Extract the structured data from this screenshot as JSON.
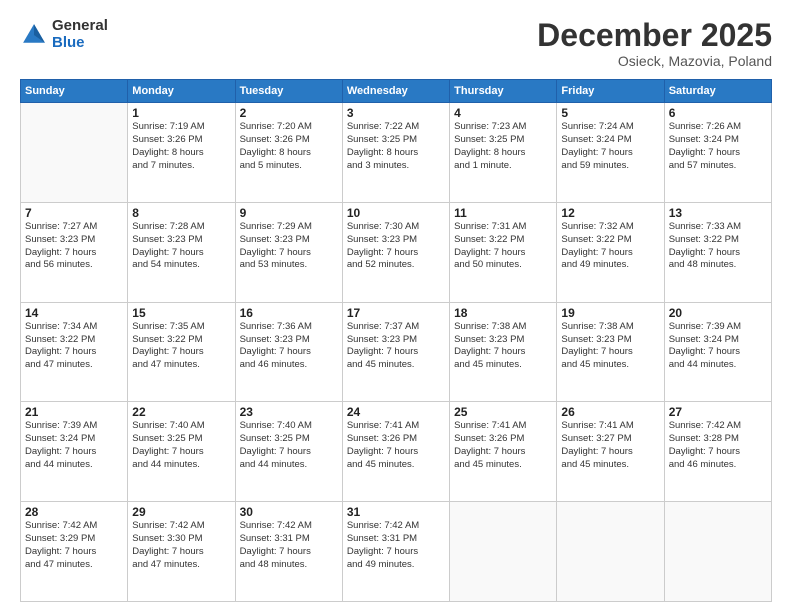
{
  "header": {
    "logo_general": "General",
    "logo_blue": "Blue",
    "month_title": "December 2025",
    "location": "Osieck, Mazovia, Poland"
  },
  "weekdays": [
    "Sunday",
    "Monday",
    "Tuesday",
    "Wednesday",
    "Thursday",
    "Friday",
    "Saturday"
  ],
  "weeks": [
    [
      {
        "day": "",
        "info": ""
      },
      {
        "day": "1",
        "info": "Sunrise: 7:19 AM\nSunset: 3:26 PM\nDaylight: 8 hours\nand 7 minutes."
      },
      {
        "day": "2",
        "info": "Sunrise: 7:20 AM\nSunset: 3:26 PM\nDaylight: 8 hours\nand 5 minutes."
      },
      {
        "day": "3",
        "info": "Sunrise: 7:22 AM\nSunset: 3:25 PM\nDaylight: 8 hours\nand 3 minutes."
      },
      {
        "day": "4",
        "info": "Sunrise: 7:23 AM\nSunset: 3:25 PM\nDaylight: 8 hours\nand 1 minute."
      },
      {
        "day": "5",
        "info": "Sunrise: 7:24 AM\nSunset: 3:24 PM\nDaylight: 7 hours\nand 59 minutes."
      },
      {
        "day": "6",
        "info": "Sunrise: 7:26 AM\nSunset: 3:24 PM\nDaylight: 7 hours\nand 57 minutes."
      }
    ],
    [
      {
        "day": "7",
        "info": "Sunrise: 7:27 AM\nSunset: 3:23 PM\nDaylight: 7 hours\nand 56 minutes."
      },
      {
        "day": "8",
        "info": "Sunrise: 7:28 AM\nSunset: 3:23 PM\nDaylight: 7 hours\nand 54 minutes."
      },
      {
        "day": "9",
        "info": "Sunrise: 7:29 AM\nSunset: 3:23 PM\nDaylight: 7 hours\nand 53 minutes."
      },
      {
        "day": "10",
        "info": "Sunrise: 7:30 AM\nSunset: 3:23 PM\nDaylight: 7 hours\nand 52 minutes."
      },
      {
        "day": "11",
        "info": "Sunrise: 7:31 AM\nSunset: 3:22 PM\nDaylight: 7 hours\nand 50 minutes."
      },
      {
        "day": "12",
        "info": "Sunrise: 7:32 AM\nSunset: 3:22 PM\nDaylight: 7 hours\nand 49 minutes."
      },
      {
        "day": "13",
        "info": "Sunrise: 7:33 AM\nSunset: 3:22 PM\nDaylight: 7 hours\nand 48 minutes."
      }
    ],
    [
      {
        "day": "14",
        "info": "Sunrise: 7:34 AM\nSunset: 3:22 PM\nDaylight: 7 hours\nand 47 minutes."
      },
      {
        "day": "15",
        "info": "Sunrise: 7:35 AM\nSunset: 3:22 PM\nDaylight: 7 hours\nand 47 minutes."
      },
      {
        "day": "16",
        "info": "Sunrise: 7:36 AM\nSunset: 3:23 PM\nDaylight: 7 hours\nand 46 minutes."
      },
      {
        "day": "17",
        "info": "Sunrise: 7:37 AM\nSunset: 3:23 PM\nDaylight: 7 hours\nand 45 minutes."
      },
      {
        "day": "18",
        "info": "Sunrise: 7:38 AM\nSunset: 3:23 PM\nDaylight: 7 hours\nand 45 minutes."
      },
      {
        "day": "19",
        "info": "Sunrise: 7:38 AM\nSunset: 3:23 PM\nDaylight: 7 hours\nand 45 minutes."
      },
      {
        "day": "20",
        "info": "Sunrise: 7:39 AM\nSunset: 3:24 PM\nDaylight: 7 hours\nand 44 minutes."
      }
    ],
    [
      {
        "day": "21",
        "info": "Sunrise: 7:39 AM\nSunset: 3:24 PM\nDaylight: 7 hours\nand 44 minutes."
      },
      {
        "day": "22",
        "info": "Sunrise: 7:40 AM\nSunset: 3:25 PM\nDaylight: 7 hours\nand 44 minutes."
      },
      {
        "day": "23",
        "info": "Sunrise: 7:40 AM\nSunset: 3:25 PM\nDaylight: 7 hours\nand 44 minutes."
      },
      {
        "day": "24",
        "info": "Sunrise: 7:41 AM\nSunset: 3:26 PM\nDaylight: 7 hours\nand 45 minutes."
      },
      {
        "day": "25",
        "info": "Sunrise: 7:41 AM\nSunset: 3:26 PM\nDaylight: 7 hours\nand 45 minutes."
      },
      {
        "day": "26",
        "info": "Sunrise: 7:41 AM\nSunset: 3:27 PM\nDaylight: 7 hours\nand 45 minutes."
      },
      {
        "day": "27",
        "info": "Sunrise: 7:42 AM\nSunset: 3:28 PM\nDaylight: 7 hours\nand 46 minutes."
      }
    ],
    [
      {
        "day": "28",
        "info": "Sunrise: 7:42 AM\nSunset: 3:29 PM\nDaylight: 7 hours\nand 47 minutes."
      },
      {
        "day": "29",
        "info": "Sunrise: 7:42 AM\nSunset: 3:30 PM\nDaylight: 7 hours\nand 47 minutes."
      },
      {
        "day": "30",
        "info": "Sunrise: 7:42 AM\nSunset: 3:31 PM\nDaylight: 7 hours\nand 48 minutes."
      },
      {
        "day": "31",
        "info": "Sunrise: 7:42 AM\nSunset: 3:31 PM\nDaylight: 7 hours\nand 49 minutes."
      },
      {
        "day": "",
        "info": ""
      },
      {
        "day": "",
        "info": ""
      },
      {
        "day": "",
        "info": ""
      }
    ]
  ]
}
